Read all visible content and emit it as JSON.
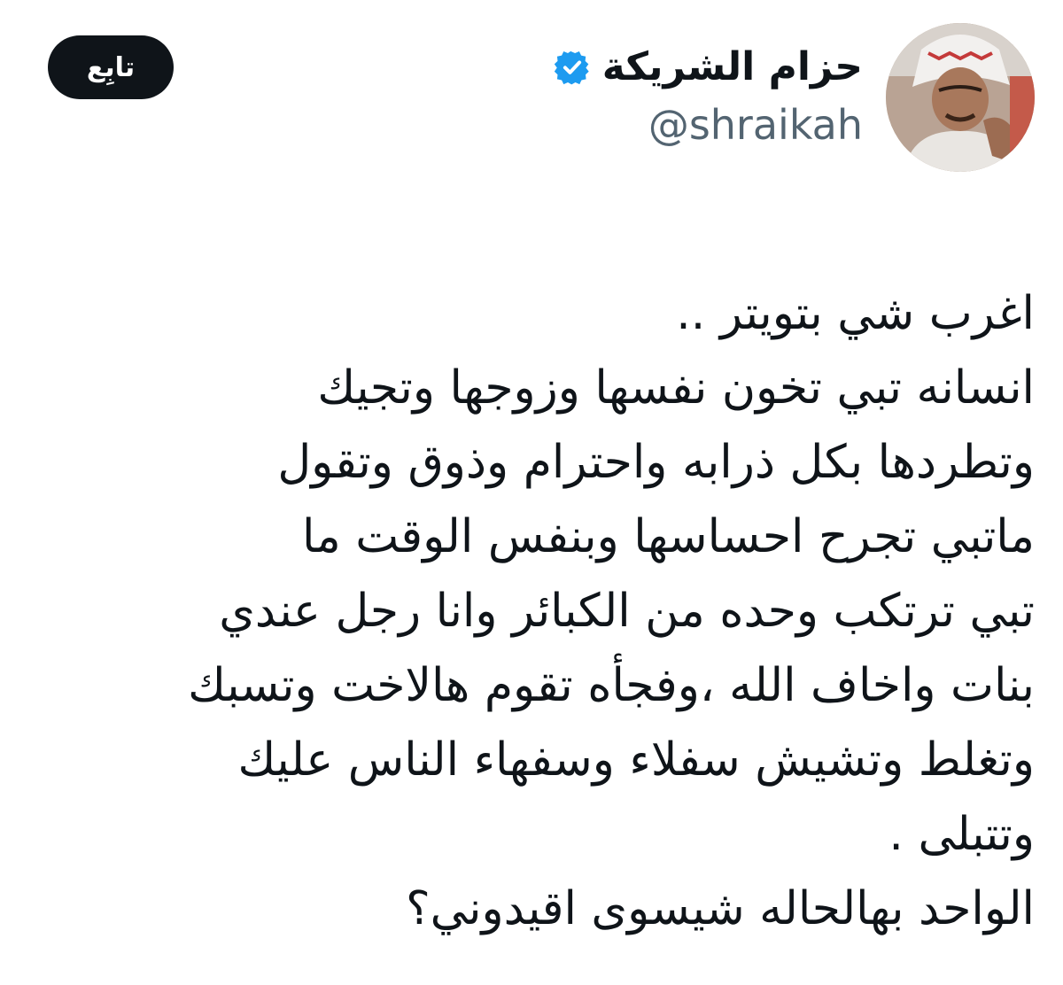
{
  "author": {
    "display_name": "حزام الشريكة",
    "handle": "@shraikah",
    "verified_icon": "verified-badge-icon",
    "avatar_icon": "profile-photo"
  },
  "actions": {
    "follow_label": "تابِع"
  },
  "tweet": {
    "lines": [
      "اغرب شي بتويتر ..",
      "انسانه تبي تخون نفسها وزوجها وتجيك",
      "وتطردها بكل ذرابه واحترام وذوق وتقول",
      "ماتبي تجرح احساسها وبنفس الوقت ما",
      "تبي ترتكب وحده من الكبائر وانا رجل عندي",
      "بنات واخاف الله ،وفجأه تقوم هالاخت وتسبك",
      "وتغلط وتشيش سفلاء وسفهاء الناس عليك",
      "وتتبلى .",
      "الواحد بهالحاله شيسوى اقيدوني؟"
    ]
  },
  "colors": {
    "text": "#0f1419",
    "secondary_text": "#536471",
    "verified_blue": "#1d9bf0",
    "follow_button_bg": "#0f1419",
    "follow_button_text": "#ffffff"
  }
}
